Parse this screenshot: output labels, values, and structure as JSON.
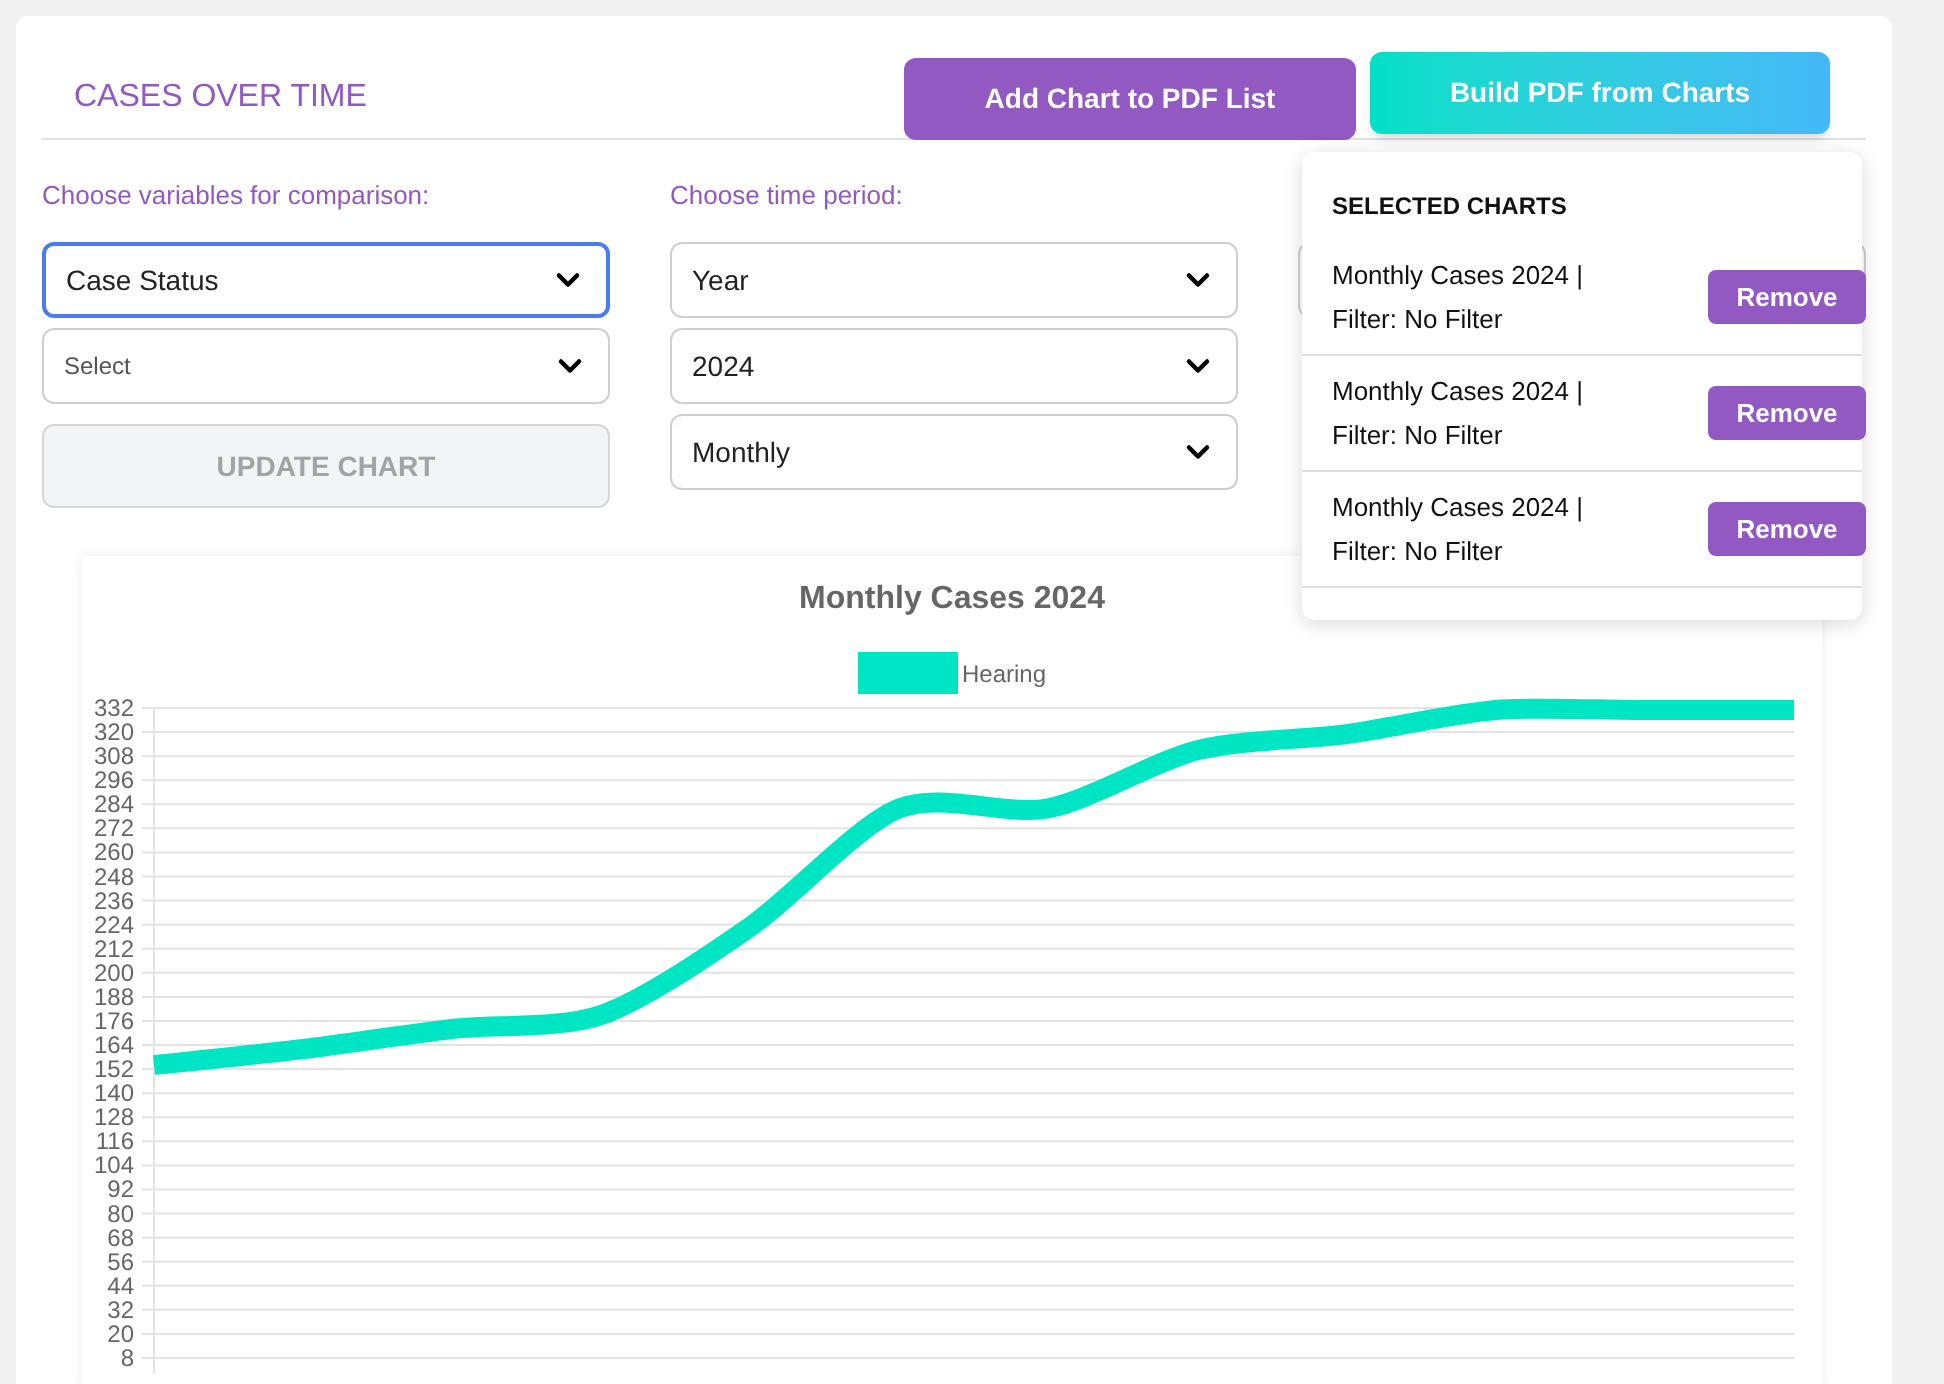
{
  "header": {
    "title": "CASES OVER TIME",
    "buttons": [
      {
        "label": "Add Chart to PDF List",
        "kind": "solid"
      },
      {
        "label": "Build PDF from Charts",
        "kind": "gradient"
      }
    ]
  },
  "controls": [
    {
      "label": "Choose variables for comparison:",
      "selects": [
        {
          "value": "Case Status",
          "focused": true,
          "kind": "value"
        },
        {
          "value": "Select",
          "focused": false,
          "kind": "placeholder"
        }
      ],
      "action": {
        "label": "UPDATE CHART",
        "disabled": true
      }
    },
    {
      "label": "Choose time period:",
      "selects": [
        {
          "value": "Year",
          "focused": false,
          "kind": "value"
        },
        {
          "value": "2024",
          "focused": false,
          "kind": "value"
        },
        {
          "value": "Monthly",
          "focused": false,
          "kind": "value"
        }
      ]
    }
  ],
  "selected_charts": {
    "title": "SELECTED CHARTS",
    "items": [
      {
        "label": "Monthly Cases 2024 | Filter: No Filter",
        "button": "Remove"
      },
      {
        "label": "Monthly Cases 2024 | Filter: No Filter",
        "button": "Remove"
      },
      {
        "label": "Monthly Cases 2024 | Filter: No Filter",
        "button": "Remove"
      }
    ]
  },
  "chart": {
    "chart_data": {
      "type": "line",
      "grid": true,
      "title": "Monthly Cases 2024",
      "ylim": [
        8,
        332
      ],
      "yticks": [
        332,
        320,
        308,
        296,
        284,
        272,
        260,
        248,
        236,
        224,
        212,
        200,
        188,
        176,
        164,
        152,
        140,
        128,
        116,
        104,
        92,
        80,
        68,
        56,
        44,
        32,
        20,
        8
      ],
      "series": [
        {
          "name": "Hearing",
          "color": "#00e5c4",
          "values": [
            154,
            162,
            172,
            179,
            223,
            282,
            282,
            311,
            319,
            331,
            331,
            331
          ]
        }
      ]
    }
  }
}
